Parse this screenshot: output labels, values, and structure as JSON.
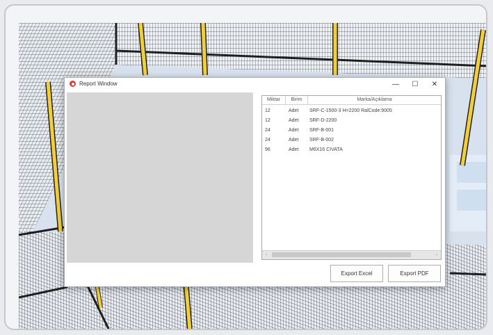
{
  "window": {
    "title": "Report Window",
    "minimize_glyph": "—",
    "maximize_glyph": "☐",
    "close_glyph": "✕"
  },
  "table": {
    "headers": [
      "Miktar",
      "Birim",
      "Marka/Açıklama"
    ],
    "rows": [
      [
        "12",
        "Adet",
        "SRF-C-1500-3 H=2200 RalCode:9005"
      ],
      [
        "12",
        "Adet",
        "SRF-D-2200"
      ],
      [
        "24",
        "Adet",
        "SRF-B-001"
      ],
      [
        "24",
        "Adet",
        "SRF-B-002"
      ],
      [
        "96",
        "Adet",
        "M6X16 CIVATA"
      ]
    ],
    "scroll_left_glyph": "‹",
    "scroll_right_glyph": "›"
  },
  "buttons": {
    "export_excel": "Export Excel",
    "export_pdf": "Export PDF"
  },
  "colors": {
    "fence_post": "#f2cf3a",
    "fence_frame": "#222222",
    "app_icon": "#d83a33"
  }
}
